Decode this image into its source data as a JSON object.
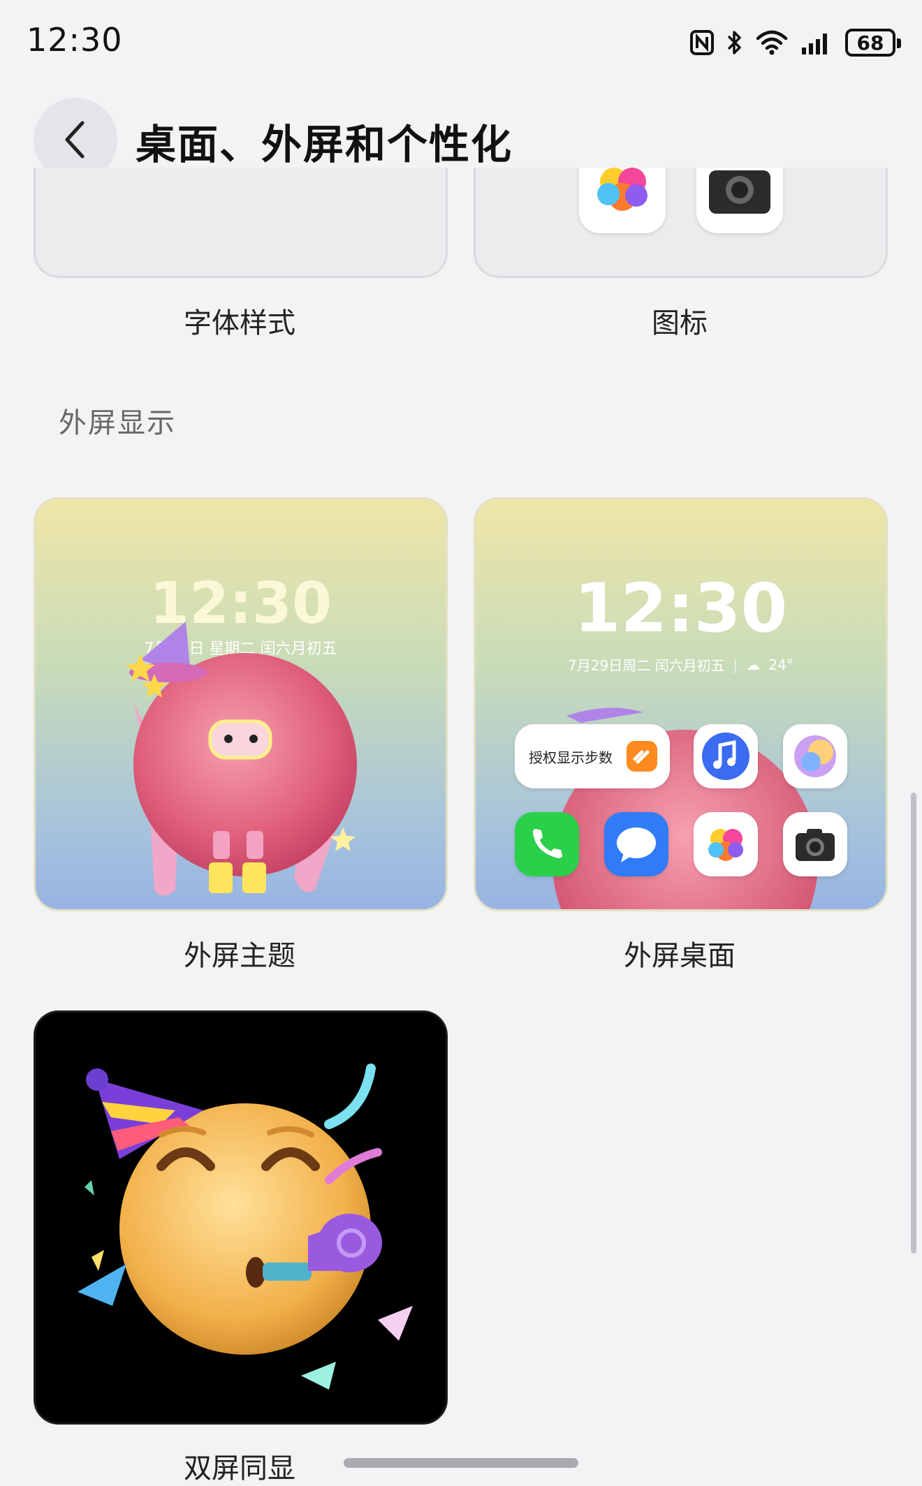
{
  "status_bar": {
    "time": "12:30",
    "battery": "68",
    "icons": [
      "nfc-icon",
      "bluetooth-icon",
      "wifi-icon",
      "signal-icon",
      "battery-icon"
    ]
  },
  "header": {
    "title": "桌面、外屏和个性化",
    "back_icon": "chevron-left-icon"
  },
  "top_cards": [
    {
      "label": "字体样式"
    },
    {
      "label": "图标"
    }
  ],
  "section": {
    "title": "外屏显示"
  },
  "outer_cards": [
    {
      "label": "外屏主题",
      "preview_time": "12:30",
      "preview_date": "7月29日  星期二  闰六月初五"
    },
    {
      "label": "外屏桌面",
      "preview_time": "12:30",
      "preview_date": "7月29日周二 闰六月初五",
      "preview_temp": "24°",
      "widget_text": "授权显示步数"
    },
    {
      "label": "双屏同显"
    }
  ],
  "colors": {
    "background": "#f2f3f5",
    "card": "#ebecee",
    "accent_orange": "#ff8a1f"
  }
}
